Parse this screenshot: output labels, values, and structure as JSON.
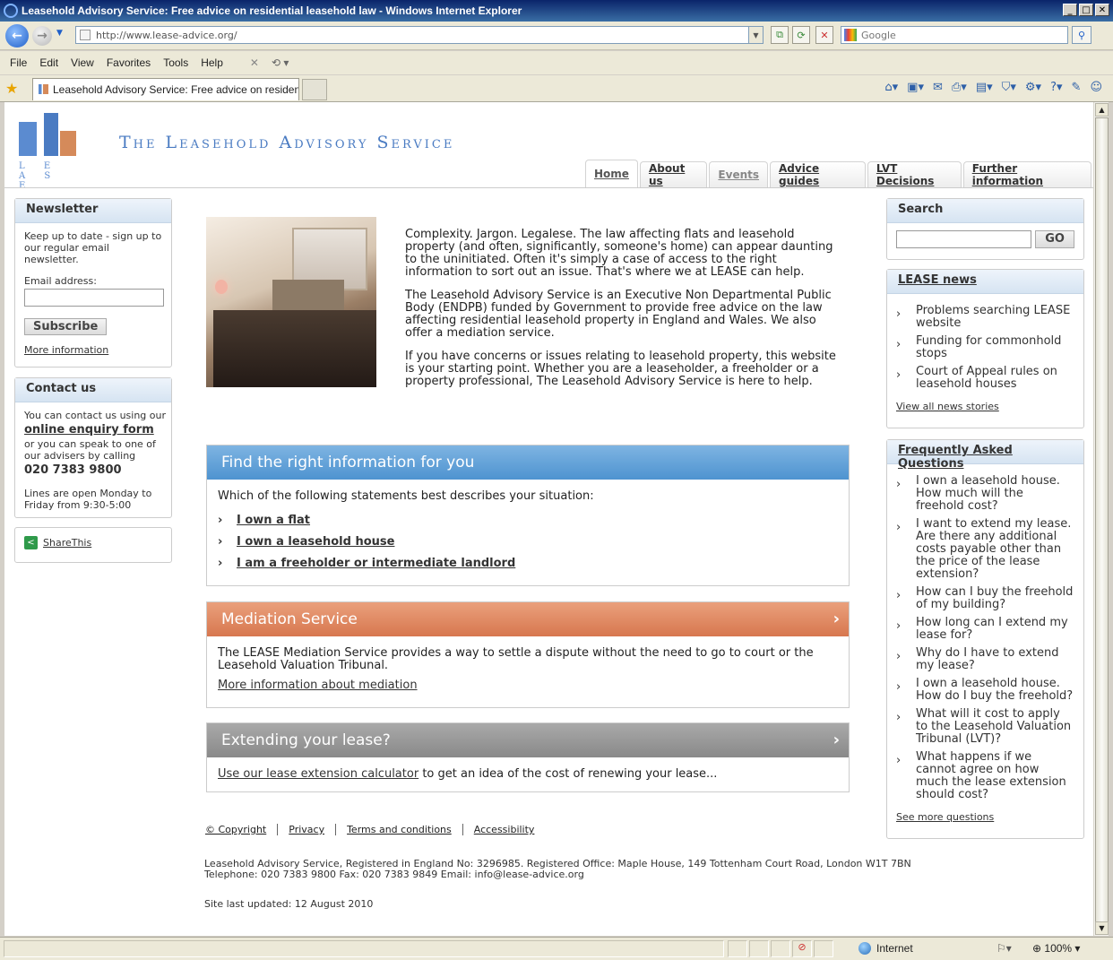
{
  "browser": {
    "window_title": "Leasehold Advisory Service: Free advice on residential leasehold law - Windows Internet Explorer",
    "url": "http://www.lease-advice.org/",
    "search_placeholder": "Google",
    "menu": [
      "File",
      "Edit",
      "View",
      "Favorites",
      "Tools",
      "Help"
    ],
    "tab_title": "Leasehold Advisory Service: Free advice on residentia...",
    "status_zone": "Internet",
    "zoom": "100%"
  },
  "site": {
    "logo_text": "L E A S E",
    "title": "The Leasehold Advisory Service",
    "nav": [
      {
        "label": "Home"
      },
      {
        "label": "About us"
      },
      {
        "label": "Events"
      },
      {
        "label": "Advice guides"
      },
      {
        "label": "LVT Decisions"
      },
      {
        "label": "Further information"
      }
    ]
  },
  "newsletter": {
    "heading": "Newsletter",
    "text": "Keep up to date - sign up to our regular email newsletter.",
    "email_label": "Email address:",
    "button": "Subscribe",
    "more": "More information"
  },
  "contact": {
    "heading": "Contact us",
    "line1": "You can contact us using our",
    "link": "online enquiry form",
    "line2": "or you can speak to one of our advisers by calling",
    "phone": "020 7383 9800",
    "hours": "Lines are open Monday to Friday from 9:30-5:00"
  },
  "share": {
    "label": "ShareThis"
  },
  "intro": {
    "p1": "Complexity. Jargon. Legalese. The law affecting flats and leasehold property (and often, significantly, someone's home) can appear daunting to the uninitiated. Often it's simply a case of access to the right information to sort out an issue. That's where we at LEASE can help.",
    "p2": "The Leasehold Advisory Service is an Executive Non Departmental Public Body (ENDPB) funded by Government to provide free advice on the law affecting residential leasehold property in England and Wales. We also offer a mediation service.",
    "p3": "If you have concerns or issues relating to leasehold property, this website is your starting point. Whether you are a leaseholder, a freeholder or a property professional, The Leasehold Advisory Service is here to help."
  },
  "find": {
    "heading": "Find the right information for you",
    "question": "Which of the following statements best describes your situation:",
    "options": [
      "I own a flat",
      "I own a leasehold house",
      "I am a freeholder or intermediate landlord"
    ]
  },
  "mediation": {
    "heading": "Mediation Service",
    "text": "The LEASE Mediation Service provides a way to settle a dispute without the need to go to court or the Leasehold Valuation Tribunal.",
    "link": "More information about mediation"
  },
  "extend": {
    "heading": "Extending your lease?",
    "link": "Use our lease extension calculator",
    "text": "to get an idea of the cost of renewing your lease..."
  },
  "search": {
    "heading": "Search",
    "button": "GO"
  },
  "news": {
    "heading": "LEASE news",
    "items": [
      "Problems searching LEASE website",
      "Funding for commonhold stops",
      "Court of Appeal rules on leasehold houses"
    ],
    "all": "View all news stories"
  },
  "faq": {
    "heading": "Frequently Asked Questions",
    "items": [
      "I own a leasehold house. How much will the freehold cost?",
      "I want to extend my lease. Are there any additional costs payable other than the price of the lease extension?",
      "How can I buy the freehold of my building?",
      "How long can I extend my lease for?",
      "Why do I have to extend my lease?",
      "I own a leasehold house. How do I buy the freehold?",
      "What will it cost to apply to the Leasehold Valuation Tribunal (LVT)?",
      "What happens if we cannot agree on how much the lease extension should cost?"
    ],
    "more": "See more questions"
  },
  "footer": {
    "links": [
      "© Copyright",
      "Privacy",
      "Terms and conditions",
      "Accessibility"
    ],
    "line1": "Leasehold Advisory Service, Registered in England No: 3296985. Registered Office: Maple House, 149 Tottenham Court Road, London W1T 7BN",
    "line2": "Telephone: 020 7383 9800 Fax: 020 7383 9849 Email: info@lease-advice.org",
    "updated": "Site last updated: 12 August 2010"
  }
}
